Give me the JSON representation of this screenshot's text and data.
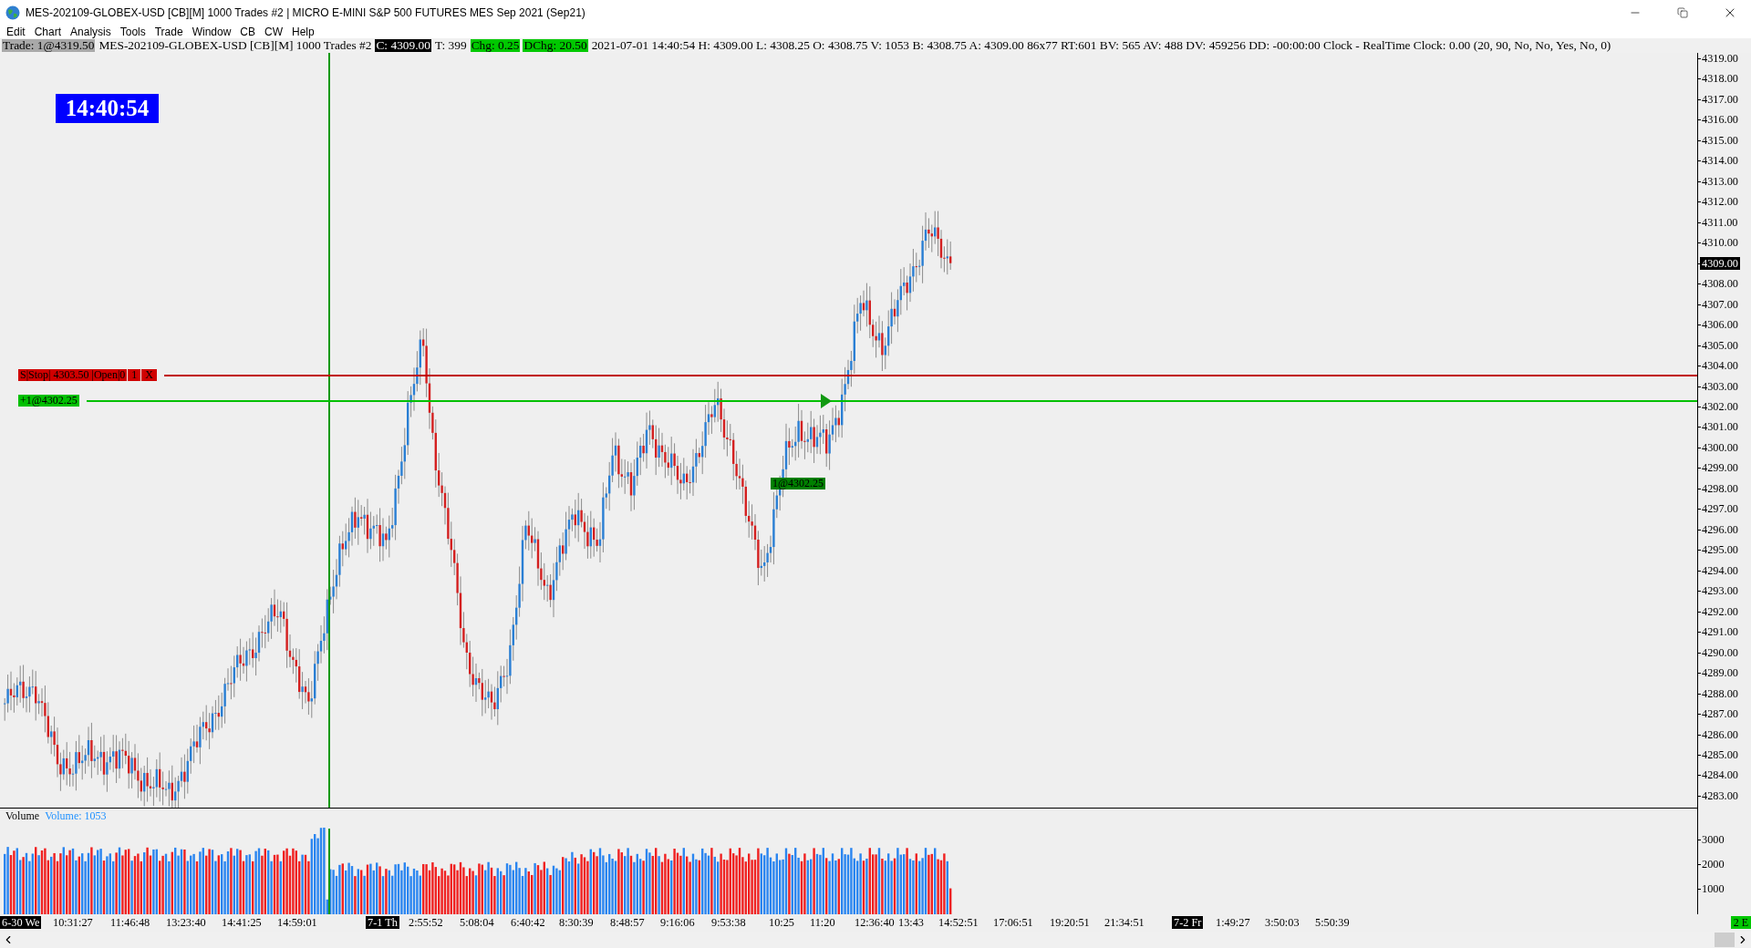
{
  "window": {
    "title": "MES-202109-GLOBEX-USD [CB][M]  1000 Trades  #2 | MICRO E-MINI S&P 500 FUTURES MES Sep 2021 (Sep21)"
  },
  "menu": [
    "Edit",
    "Chart",
    "Analysis",
    "Tools",
    "Trade",
    "Window",
    "CB",
    "CW",
    "Help"
  ],
  "header": [
    {
      "text": "Trade: 1@4319.50",
      "kind": "grey"
    },
    {
      "text": "MES-202109-GLOBEX-USD [CB][M]  1000 Trades  #2",
      "kind": "plain"
    },
    {
      "text": "C: 4309.00",
      "kind": "black"
    },
    {
      "text": "T: 399",
      "kind": "plain"
    },
    {
      "text": "Chg: 0.25",
      "kind": "green"
    },
    {
      "text": "DChg: 20.50",
      "kind": "green"
    },
    {
      "text": "2021-07-01 14:40:54 H: 4309.00 L: 4308.25 O: 4308.75 V: 1053 B: 4308.75 A: 4309.00 86x77 RT:601 BV: 565 AV: 488 DV: 459256 DD: -00:00:00 Clock - RealTime  Clock: 0.00   (20, 90, No, No, Yes, No, 0)",
      "kind": "plain"
    }
  ],
  "clock": "14:40:54",
  "stop_order": {
    "label": "S|Stop| 4303.50 |Open|0",
    "quantity": "1",
    "cancel": "X"
  },
  "position_label": "+1@4302.25",
  "fill_label": "1@4302.25",
  "price_axis": [
    {
      "label": "4319.00",
      "kind": "tick"
    },
    {
      "label": "4318.00",
      "kind": "tick"
    },
    {
      "label": "4317.00",
      "kind": "tick"
    },
    {
      "label": "4316.00",
      "kind": "tick"
    },
    {
      "label": "4315.00",
      "kind": "tick"
    },
    {
      "label": "4314.00",
      "kind": "tick"
    },
    {
      "label": "4313.00",
      "kind": "tick"
    },
    {
      "label": "4312.00",
      "kind": "tick"
    },
    {
      "label": "4311.00",
      "kind": "tick"
    },
    {
      "label": "4310.00",
      "kind": "tick"
    },
    {
      "label": "4309.00",
      "kind": "current"
    },
    {
      "label": "4308.00",
      "kind": "tick"
    },
    {
      "label": "4307.00",
      "kind": "tick"
    },
    {
      "label": "4306.00",
      "kind": "tick"
    },
    {
      "label": "4305.00",
      "kind": "tick"
    },
    {
      "label": "4304.00",
      "kind": "tick"
    },
    {
      "label": "4303.00",
      "kind": "tick"
    },
    {
      "label": "4302.00",
      "kind": "tick"
    },
    {
      "label": "4301.00",
      "kind": "tick"
    },
    {
      "label": "4300.00",
      "kind": "tick"
    },
    {
      "label": "4299.00",
      "kind": "tick"
    },
    {
      "label": "4298.00",
      "kind": "tick"
    },
    {
      "label": "4297.00",
      "kind": "tick"
    },
    {
      "label": "4296.00",
      "kind": "tick"
    },
    {
      "label": "4295.00",
      "kind": "tick"
    },
    {
      "label": "4294.00",
      "kind": "tick"
    },
    {
      "label": "4293.00",
      "kind": "tick"
    },
    {
      "label": "4292.00",
      "kind": "tick"
    },
    {
      "label": "4291.00",
      "kind": "tick"
    },
    {
      "label": "4290.00",
      "kind": "tick"
    },
    {
      "label": "4289.00",
      "kind": "tick"
    },
    {
      "label": "4288.00",
      "kind": "tick"
    },
    {
      "label": "4287.00",
      "kind": "tick"
    },
    {
      "label": "4286.00",
      "kind": "tick"
    },
    {
      "label": "4285.00",
      "kind": "tick"
    },
    {
      "label": "4284.00",
      "kind": "tick"
    },
    {
      "label": "4283.00",
      "kind": "tick"
    }
  ],
  "volume": {
    "title": "Volume",
    "reading": "Volume: 1053",
    "axis": [
      "3000",
      "2000",
      "1000"
    ]
  },
  "time_axis": [
    {
      "label": "6-30 We",
      "kind": "date"
    },
    {
      "label": "10:31:27",
      "kind": "time"
    },
    {
      "label": "11:46:48",
      "kind": "time"
    },
    {
      "label": "13:23:40",
      "kind": "time"
    },
    {
      "label": "14:41:25",
      "kind": "time"
    },
    {
      "label": "14:59:01",
      "kind": "time"
    },
    {
      "label": "7-1 Th",
      "kind": "date"
    },
    {
      "label": "2:55:52",
      "kind": "time"
    },
    {
      "label": "5:08:04",
      "kind": "time"
    },
    {
      "label": "6:40:42",
      "kind": "time"
    },
    {
      "label": "8:30:39",
      "kind": "time"
    },
    {
      "label": "8:48:57",
      "kind": "time"
    },
    {
      "label": "9:16:06",
      "kind": "time"
    },
    {
      "label": "9:53:38",
      "kind": "time"
    },
    {
      "label": "10:25",
      "kind": "time"
    },
    {
      "label": "11:20",
      "kind": "time"
    },
    {
      "label": "12:36:40",
      "kind": "time"
    },
    {
      "label": "13:43",
      "kind": "time"
    },
    {
      "label": "14:52:51",
      "kind": "time"
    },
    {
      "label": "17:06:51",
      "kind": "time"
    },
    {
      "label": "19:20:51",
      "kind": "time"
    },
    {
      "label": "21:34:51",
      "kind": "time"
    },
    {
      "label": "7-2 Fr",
      "kind": "date"
    },
    {
      "label": "1:49:27",
      "kind": "time"
    },
    {
      "label": "3:50:03",
      "kind": "time"
    },
    {
      "label": "5:50:39",
      "kind": "time"
    }
  ],
  "status_badge": "2 E"
}
